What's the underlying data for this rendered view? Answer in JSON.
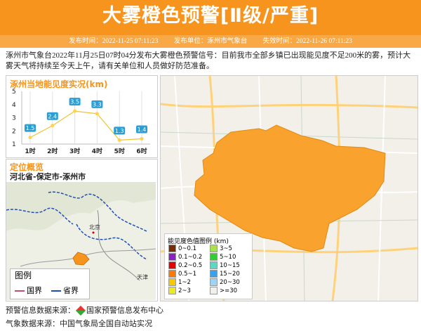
{
  "header": {
    "title": "大雾橙色预警[Ⅱ级/严重]",
    "issue_time_label": "发布时间：2022-11-25 07:11:23",
    "issuer_label": "发布单位：涿州市气象台",
    "expire_label": "失效时间：2022-11-26 07:11:23"
  },
  "description": "涿州市气象台2022年11月25日07时04分发布大雾橙色预警信号：目前我市全部乡镇已出现能见度不足200米的雾，预计大雾天气将持续至今天上午，请有关单位和人员做好防范准备。",
  "chart_panel": {
    "title": "涿州当地能见度实况(km)"
  },
  "chart_data": {
    "type": "line",
    "categories": [
      "1时",
      "2时",
      "3时",
      "4时",
      "5时",
      "6时"
    ],
    "values": [
      1.5,
      2.4,
      3.5,
      3.3,
      1.3,
      1.4
    ],
    "data_labels": [
      "1.5",
      "2.4",
      "3.5",
      "3.3",
      "1.3",
      "1.4"
    ],
    "yticks": [
      "1",
      "2",
      "3",
      "4",
      "5"
    ],
    "ylim": [
      1,
      5
    ],
    "title": "涿州当地能见度实况(km)",
    "colors": {
      "line": "#f1c232",
      "point": "#ffd24d",
      "label_bg": "#2a9fd6"
    }
  },
  "location_panel": {
    "title": "定位概览",
    "region": "河北省-保定市-涿州市",
    "city_labels": {
      "beijing": "北京",
      "tianjin": "天津"
    },
    "legend_title": "图例",
    "legend_items": [
      {
        "label": "国界",
        "color": "#c0506a"
      },
      {
        "label": "省界",
        "color": "#1f4fb5"
      }
    ]
  },
  "map_legend": {
    "title": "能见度色值图例 (km)",
    "items": [
      {
        "label": "0~0.1",
        "color": "#7b2b00"
      },
      {
        "label": "3~5",
        "color": "#a6e34a"
      },
      {
        "label": "0.1~0.2",
        "color": "#8e1ec8"
      },
      {
        "label": "5~10",
        "color": "#33cc33"
      },
      {
        "label": "0.2~0.5",
        "color": "#e80000"
      },
      {
        "label": "10~15",
        "color": "#5fd6c2"
      },
      {
        "label": "0.5~1",
        "color": "#ff7a00"
      },
      {
        "label": "15~20",
        "color": "#3aa0e8"
      },
      {
        "label": "1~2",
        "color": "#f5c800"
      },
      {
        "label": "20~30",
        "color": "#9fd3f5"
      },
      {
        "label": "2~3",
        "color": "#eaea20"
      },
      {
        "label": ">=30",
        "color": "#f0f0f0"
      }
    ]
  },
  "footer": {
    "warning_source": "预警信息数据来源：",
    "warning_source_name": "国家预警信息发布中心",
    "weather_source": "气象数据来源：中国气象局全国自动站实况"
  },
  "colors": {
    "accent": "#f7941d",
    "fog_area": "#f9a32e"
  }
}
